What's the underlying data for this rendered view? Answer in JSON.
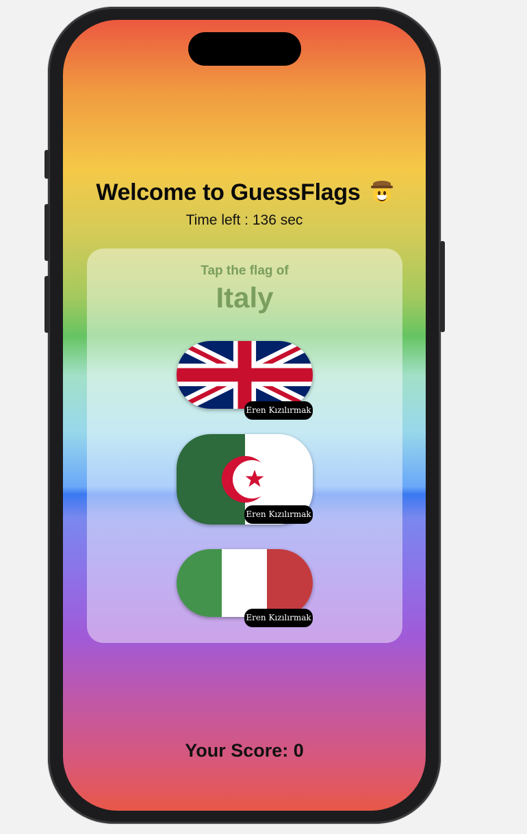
{
  "app": {
    "title": "Welcome to GuessFlags",
    "title_emoji": "cowboy-face-emoji",
    "timer_text": "Time left : 136 sec",
    "prompt_label": "Tap the flag of",
    "target_country": "Italy",
    "score_text": "Your Score: 0"
  },
  "flags": [
    {
      "country": "United Kingdom",
      "icon": "uk-flag-icon",
      "credit": "Eren Kızılırmak"
    },
    {
      "country": "Algeria",
      "icon": "algeria-flag-icon",
      "credit": "Eren Kızılırmak"
    },
    {
      "country": "Italy",
      "icon": "italy-flag-icon",
      "credit": "Eren Kızılırmak"
    }
  ],
  "colors": {
    "accent_text": "#7a9e5e",
    "uk_blue": "#012169",
    "uk_red": "#C8102E",
    "algeria_green": "#2D6A3C",
    "algeria_red": "#D21034",
    "italy_green": "#43934C",
    "italy_red": "#C33B3E"
  }
}
